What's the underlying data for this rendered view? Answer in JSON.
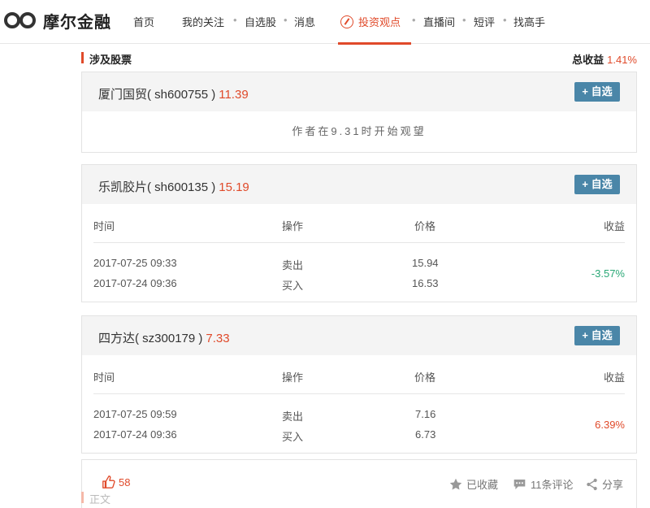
{
  "brand": {
    "name": "摩尔金融"
  },
  "nav": {
    "items": [
      "首页",
      "我的关注",
      "自选股",
      "消息",
      "投资观点",
      "直播间",
      "短评",
      "找高手"
    ],
    "active": "投资观点"
  },
  "section": {
    "title": "涉及股票",
    "total_label": "总收益",
    "total_value": "1.41%"
  },
  "add_label": "+ 自选",
  "table_headers": [
    "时间",
    "操作",
    "价格",
    "收益"
  ],
  "stocks": [
    {
      "name": "厦门国贸( sh600755 )",
      "price": "11.39",
      "note": "作者在9.31时开始观望"
    },
    {
      "name": "乐凯胶片( sh600135 )",
      "price": "15.19",
      "rows": [
        {
          "time": "2017-07-25 09:33",
          "op": "卖出",
          "price": "15.94"
        },
        {
          "time": "2017-07-24 09:36",
          "op": "买入",
          "price": "16.53"
        }
      ],
      "gain": "-3.57%"
    },
    {
      "name": "四方达( sz300179 )",
      "price": "7.33",
      "rows": [
        {
          "time": "2017-07-25 09:59",
          "op": "卖出",
          "price": "7.16"
        },
        {
          "time": "2017-07-24 09:36",
          "op": "买入",
          "price": "6.73"
        }
      ],
      "gain": "6.39%"
    }
  ],
  "footer": {
    "likes": "58",
    "collected": "已收藏",
    "comments": "11条评论",
    "share": "分享"
  },
  "body_section": {
    "title": "正文"
  },
  "colors": {
    "accent": "#e04a2a",
    "button": "#4a86a8",
    "loss": "#2aa876"
  }
}
